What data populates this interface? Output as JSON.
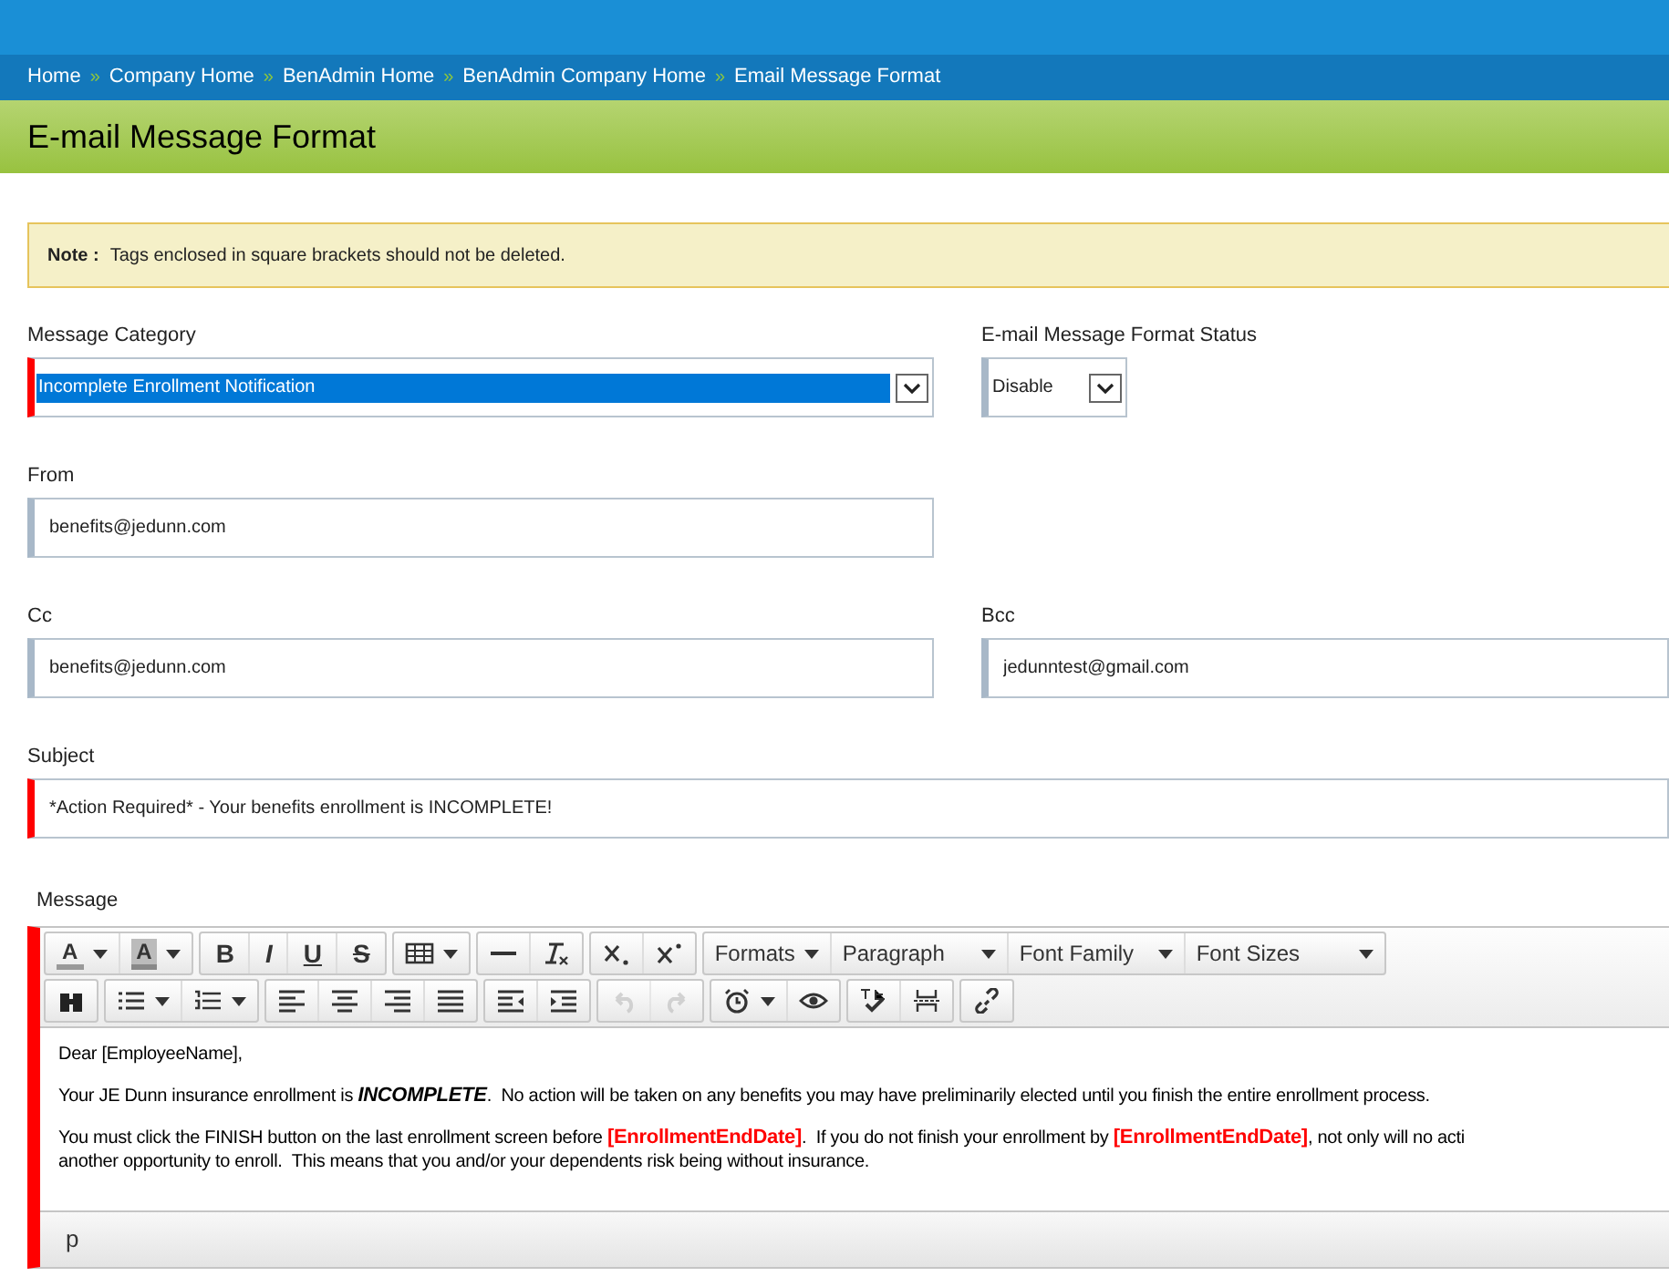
{
  "breadcrumb": [
    "Home",
    "Company Home",
    "BenAdmin Home",
    "BenAdmin Company Home",
    "Email Message Format"
  ],
  "breadcrumb_separator": "»",
  "page_title": "E-mail Message Format",
  "note": {
    "label": "Note :",
    "text": "Tags enclosed in square brackets should not be deleted."
  },
  "fields": [
    {
      "label": "Message Category",
      "kind": "select",
      "value": "Incomplete Enrollment Notification",
      "required": true,
      "highlighted": true
    },
    {
      "label": "E-mail Message Format Status",
      "kind": "select",
      "value": "Disable",
      "required": false,
      "highlighted": false
    },
    {
      "label": "From",
      "kind": "text",
      "value": "benefits@jedunn.com",
      "required": false
    },
    {
      "label": "Cc",
      "kind": "text",
      "value": "benefits@jedunn.com",
      "required": false
    },
    {
      "label": "Bcc",
      "kind": "text",
      "value": "jedunntest@gmail.com",
      "required": false
    },
    {
      "label": "Subject",
      "kind": "text",
      "value": "*Action Required* - Your benefits enrollment is INCOMPLETE!",
      "required": true
    }
  ],
  "message": {
    "label": "Message",
    "required": true,
    "toolbar": [
      [
        [
          {
            "kind": "split_glyph",
            "text": "A"
          },
          {
            "kind": "split_glyph",
            "text": "A",
            "shaded": true
          }
        ],
        [
          {
            "kind": "glyph",
            "text": "B"
          },
          {
            "kind": "glyph",
            "text": "I"
          },
          {
            "kind": "glyph",
            "text": "U"
          },
          {
            "kind": "glyph",
            "text": "S"
          }
        ],
        [
          {
            "kind": "split_icon"
          }
        ],
        [
          {
            "kind": "icon"
          },
          {
            "kind": "icon"
          }
        ],
        [
          {
            "kind": "icon"
          },
          {
            "kind": "icon"
          }
        ],
        [
          {
            "kind": "dropdown",
            "text": "Formats"
          },
          {
            "kind": "dropdown",
            "text": "Paragraph"
          },
          {
            "kind": "dropdown",
            "text": "Font Family"
          },
          {
            "kind": "dropdown",
            "text": "Font Sizes"
          }
        ]
      ],
      [
        [
          {
            "kind": "icon"
          }
        ],
        [
          {
            "kind": "split_icon"
          },
          {
            "kind": "split_icon"
          }
        ],
        [
          {
            "kind": "icon"
          },
          {
            "kind": "icon"
          },
          {
            "kind": "icon"
          },
          {
            "kind": "icon"
          }
        ],
        [
          {
            "kind": "icon"
          },
          {
            "kind": "icon"
          }
        ],
        [
          {
            "kind": "icon",
            "disabled": true
          },
          {
            "kind": "icon",
            "disabled": true
          }
        ],
        [
          {
            "kind": "split_icon"
          },
          {
            "kind": "icon"
          }
        ],
        [
          {
            "kind": "icon"
          },
          {
            "kind": "icon"
          }
        ],
        [
          {
            "kind": "icon"
          }
        ]
      ]
    ],
    "paragraphs": [
      [
        [
          {
            "kind": "plain",
            "text": "Dear [EmployeeName],"
          }
        ]
      ],
      [
        [
          {
            "kind": "plain",
            "text": "Your JE Dunn insurance enrollment is "
          },
          {
            "kind": "emphasis",
            "text": "INCOMPLETE"
          },
          {
            "kind": "plain",
            "text": ".  No action will be taken on any benefits you may have preliminarily elected until you finish the entire enrollment process."
          }
        ]
      ],
      [
        [
          {
            "kind": "plain",
            "text": "You must click the FINISH button on the last enrollment screen before "
          },
          {
            "kind": "tag",
            "text": "[EnrollmentEndDate]"
          },
          {
            "kind": "plain",
            "text": ".  If you do not finish your enrollment by "
          },
          {
            "kind": "tag",
            "text": "[EnrollmentEndDate]"
          },
          {
            "kind": "plain",
            "text": ", not only will no acti"
          }
        ],
        [
          {
            "kind": "plain",
            "text": "another opportunity to enroll.  This means that you and/or your dependents risk being without insurance."
          }
        ]
      ]
    ],
    "path": "p"
  }
}
